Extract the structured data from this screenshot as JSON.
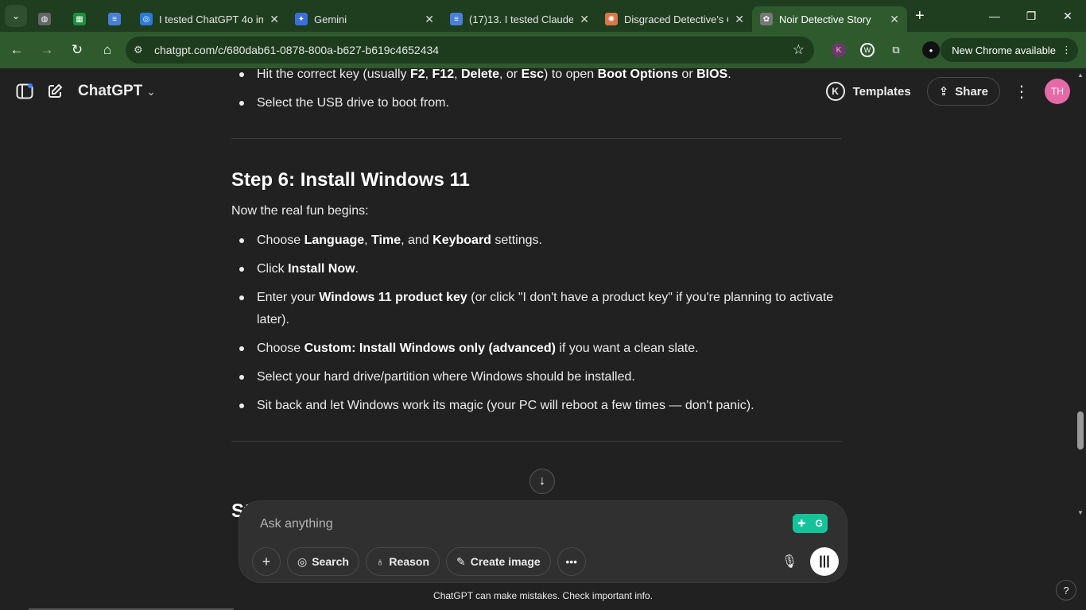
{
  "browser": {
    "tabs": [
      {
        "title": "",
        "icon": "globe-icon",
        "pinned": true
      },
      {
        "title": "",
        "icon": "sheets-icon",
        "pinned": true
      },
      {
        "title": "",
        "icon": "docs-icon",
        "pinned": true
      },
      {
        "title": "I tested ChatGPT 4o im",
        "icon": "hyperwrite-icon"
      },
      {
        "title": "Gemini",
        "icon": "gemini-icon"
      },
      {
        "title": "(17)13. I tested Claude",
        "icon": "docs-icon"
      },
      {
        "title": "Disgraced Detective's C",
        "icon": "claude-icon"
      },
      {
        "title": "Noir Detective Story",
        "icon": "chatgpt-icon",
        "active": true
      }
    ],
    "url": "chatgpt.com/c/680dab61-0878-800a-b627-b619c4652434",
    "update_label": "New Chrome available"
  },
  "header": {
    "model": "ChatGPT",
    "templates_badge": "K",
    "templates_label": "Templates",
    "share_label": "Share",
    "avatar_initials": "TH"
  },
  "conversation": {
    "top_bullets": [
      [
        {
          "t": "Hit the correct key (usually "
        },
        {
          "t": "F2",
          "b": true
        },
        {
          "t": ", "
        },
        {
          "t": "F12",
          "b": true
        },
        {
          "t": ", "
        },
        {
          "t": "Delete",
          "b": true
        },
        {
          "t": ", or "
        },
        {
          "t": "Esc",
          "b": true
        },
        {
          "t": ") to open "
        },
        {
          "t": "Boot Options",
          "b": true
        },
        {
          "t": " or "
        },
        {
          "t": "BIOS",
          "b": true
        },
        {
          "t": "."
        }
      ],
      [
        {
          "t": "Select the USB drive to boot from."
        }
      ]
    ],
    "step_prefix": "Step 6: ",
    "step_title": "Install Windows 11",
    "intro": "Now the real fun begins:",
    "bullets": [
      [
        {
          "t": "Choose "
        },
        {
          "t": "Language",
          "b": true
        },
        {
          "t": ", "
        },
        {
          "t": "Time",
          "b": true
        },
        {
          "t": ", and "
        },
        {
          "t": "Keyboard",
          "b": true
        },
        {
          "t": " settings."
        }
      ],
      [
        {
          "t": "Click "
        },
        {
          "t": "Install Now",
          "b": true
        },
        {
          "t": "."
        }
      ],
      [
        {
          "t": "Enter your "
        },
        {
          "t": "Windows 11 product key",
          "b": true
        },
        {
          "t": " (or click \"I don't have a product key\" if you're planning to activate later)."
        }
      ],
      [
        {
          "t": "Choose "
        },
        {
          "t": "Custom: Install Windows only (advanced)",
          "b": true
        },
        {
          "t": " if you want a clean slate."
        }
      ],
      [
        {
          "t": "Select your hard drive/partition where Windows should be installed."
        }
      ],
      [
        {
          "t": "Sit back and let Windows work its magic (your PC will reboot a few times — don't panic)."
        }
      ]
    ],
    "peek_text": "St"
  },
  "composer": {
    "placeholder": "Ask anything",
    "search_label": "Search",
    "reason_label": "Reason",
    "create_image_label": "Create image"
  },
  "footer": {
    "disclaimer": "ChatGPT can make mistakes. Check important info.",
    "help": "?"
  }
}
